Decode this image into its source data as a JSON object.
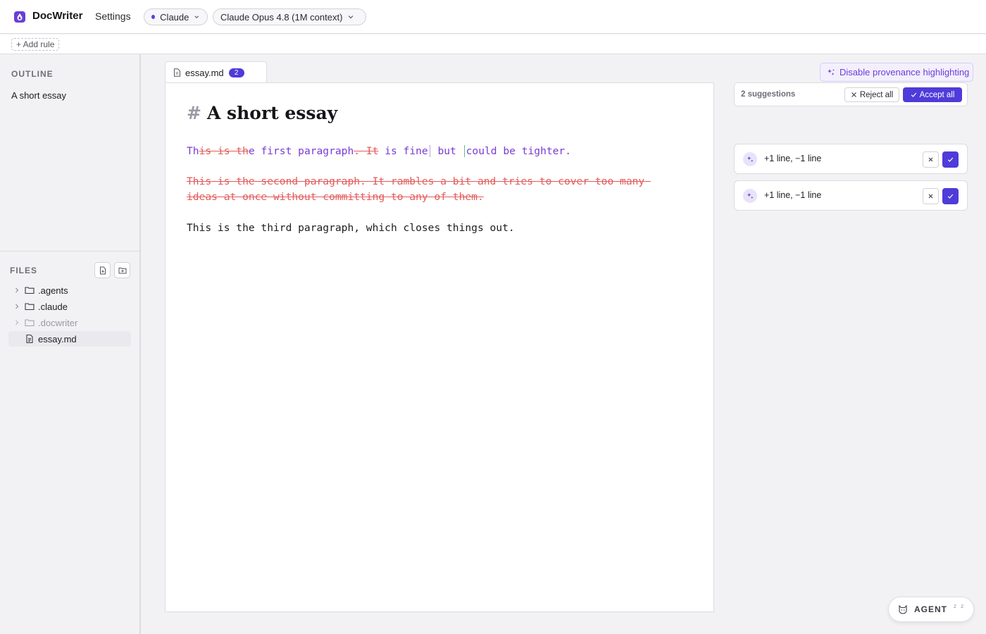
{
  "app": {
    "name": "DocWriter",
    "settings_label": "Settings",
    "provider": "Claude",
    "model": "Claude Opus 4.8 (1M context)",
    "accent_color": "#4f3bd9"
  },
  "rules": {
    "add_label": "+ Add rule"
  },
  "outline": {
    "heading": "OUTLINE",
    "items": [
      "A short essay"
    ]
  },
  "files": {
    "heading": "FILES",
    "tree": [
      {
        "name": ".agents",
        "type": "folder"
      },
      {
        "name": ".claude",
        "type": "folder"
      },
      {
        "name": ".docwriter",
        "type": "folder",
        "dimmed": true
      },
      {
        "name": "essay.md",
        "type": "file",
        "selected": true
      }
    ]
  },
  "tab": {
    "name": "essay.md",
    "badge": "2"
  },
  "document": {
    "heading_marker": "#",
    "title": "A short essay",
    "p1": {
      "a": "Th",
      "del1": "is is th",
      "b": "e first paragraph",
      "del2": ". It",
      "c": " is fine",
      "d": " but ",
      "e": "could be tighter."
    },
    "p2_deleted": "This is the second paragraph. It rambles a bit and tries to cover too many ideas at once without committing to any of them.",
    "p3": "This is the third paragraph, which closes things out."
  },
  "provenance": {
    "toggle_label": "Disable provenance highlighting"
  },
  "suggestions": {
    "count_label": "2 suggestions",
    "reject_all_label": "Reject all",
    "accept_all_label": "Accept all",
    "items": [
      {
        "summary": "+1 line, −1 line"
      },
      {
        "summary": "+1 line, −1 line"
      }
    ]
  },
  "agent": {
    "label": "AGENT",
    "status": "z z"
  }
}
